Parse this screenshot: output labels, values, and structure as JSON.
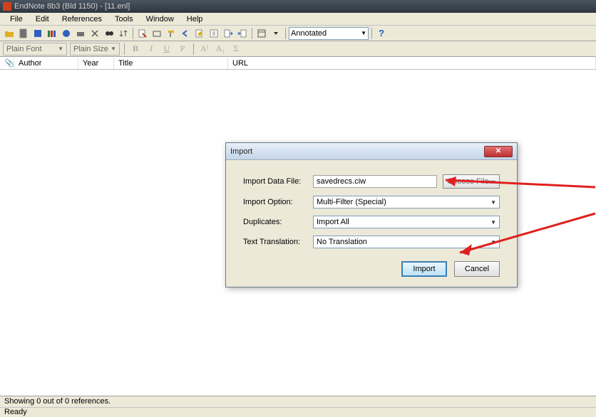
{
  "titlebar": {
    "title": "EndNote 8b3 (Bld 1150) - [11.enl]"
  },
  "menubar": {
    "items": [
      "File",
      "Edit",
      "References",
      "Tools",
      "Window",
      "Help"
    ]
  },
  "toolbar": {
    "annotated": "Annotated"
  },
  "fmtbar": {
    "font": "Plain Font",
    "size": "Plain Size",
    "bold": "B",
    "italic": "I",
    "underline": "U",
    "plain": "P",
    "super": "A¹",
    "sub": "A₁",
    "sigma": "Σ"
  },
  "columns": {
    "clip": "📎",
    "author": "Author",
    "year": "Year",
    "title": "Title",
    "url": "URL"
  },
  "dialog": {
    "title": "Import",
    "rows": {
      "datafile_label": "Import Data File:",
      "datafile_value": "savedrecs.ciw",
      "choose_file": "Choose File...",
      "option_label": "Import Option:",
      "option_value": "Multi-Filter (Special)",
      "duplicates_label": "Duplicates:",
      "duplicates_value": "Import All",
      "translation_label": "Text Translation:",
      "translation_value": "No Translation"
    },
    "buttons": {
      "import": "Import",
      "cancel": "Cancel"
    }
  },
  "status": {
    "count": "Showing 0 out of 0 references.",
    "ready": "Ready"
  }
}
